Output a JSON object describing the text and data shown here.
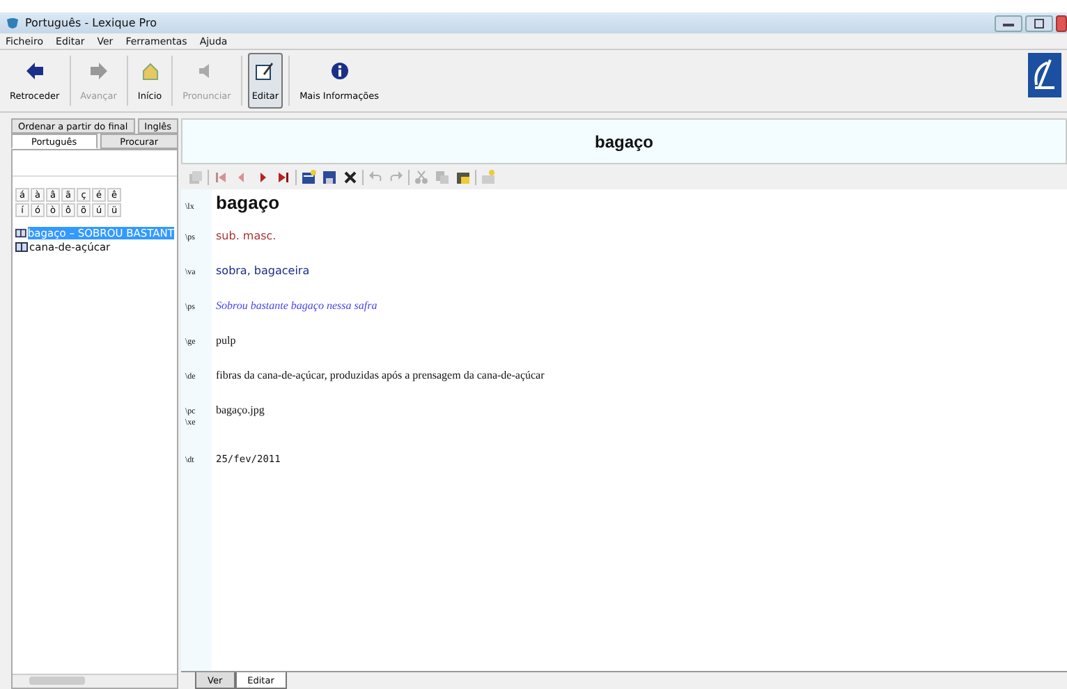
{
  "window": {
    "title": "Português - Lexique Pro"
  },
  "menu": [
    "Ficheiro",
    "Editar",
    "Ver",
    "Ferramentas",
    "Ajuda"
  ],
  "toolbar": [
    {
      "kind": "back",
      "label": "Retroceder",
      "disabled": false,
      "selected": false
    },
    {
      "kind": "forward",
      "label": "Avançar",
      "disabled": true,
      "selected": false
    },
    {
      "kind": "home",
      "label": "Início",
      "disabled": false,
      "selected": false
    },
    {
      "kind": "speaker",
      "label": "Pronunciar",
      "disabled": true,
      "selected": false
    },
    {
      "kind": "edit",
      "label": "Editar",
      "disabled": false,
      "selected": true
    },
    {
      "kind": "info",
      "label": "Mais Informações",
      "disabled": false,
      "selected": false
    }
  ],
  "index_tabs": [
    [
      {
        "label": "Ordenar a partir do final",
        "selected": false
      },
      {
        "label": "Inglês",
        "selected": false
      }
    ],
    [
      {
        "label": "Português",
        "selected": true
      },
      {
        "label": "Procurar",
        "selected": false
      }
    ]
  ],
  "special_chars": [
    [
      "á",
      "à",
      "â",
      "ã",
      "ç",
      "é",
      "ê"
    ],
    [
      "í",
      "ó",
      "ò",
      "ô",
      "õ",
      "ú",
      "ü"
    ]
  ],
  "word_list": [
    {
      "text": "bagaço – SOBROU BASTANT",
      "selected": true
    },
    {
      "text": "cana-de-açúcar",
      "selected": false
    }
  ],
  "entry_title": "bagaço",
  "editor_tools": [
    {
      "kind": "copy",
      "disabled": true
    },
    {
      "kind": "sep"
    },
    {
      "kind": "first",
      "disabled": true
    },
    {
      "kind": "prev",
      "disabled": true
    },
    {
      "kind": "next",
      "disabled": false
    },
    {
      "kind": "last",
      "disabled": false
    },
    {
      "kind": "sep"
    },
    {
      "kind": "new",
      "disabled": false
    },
    {
      "kind": "save",
      "disabled": false
    },
    {
      "kind": "delete",
      "disabled": false
    },
    {
      "kind": "sep"
    },
    {
      "kind": "undo",
      "disabled": true
    },
    {
      "kind": "redo",
      "disabled": true
    },
    {
      "kind": "sep"
    },
    {
      "kind": "cut",
      "disabled": true
    },
    {
      "kind": "paste",
      "disabled": true
    },
    {
      "kind": "clipboard",
      "disabled": false
    },
    {
      "kind": "sep"
    },
    {
      "kind": "abc",
      "disabled": false
    }
  ],
  "fields": [
    {
      "marker": "\\lx",
      "kind": "headword",
      "value": "bagaço"
    },
    {
      "marker": "\\ps",
      "kind": "pos",
      "value": "sub. masc."
    },
    {
      "marker": "\\va",
      "kind": "variant",
      "value": "sobra, bagaceira"
    },
    {
      "marker": "\\ps",
      "kind": "example",
      "value": "Sobrou bastante bagaço nessa safra"
    },
    {
      "marker": "\\ge",
      "kind": "plain",
      "value": "pulp"
    },
    {
      "marker": "\\de",
      "kind": "plain",
      "value": "fibras da cana-de-açúcar, produzidas após a prensagem da cana-de-açúcar"
    },
    {
      "marker": "\\pc",
      "kind": "plain",
      "value": "bagaço.jpg"
    },
    {
      "marker": "\\xe",
      "kind": "empty"
    },
    {
      "marker": "\\dt",
      "kind": "date",
      "value": "25/fev/2011"
    }
  ],
  "view_tabs": [
    {
      "label": "Ver",
      "selected": false
    },
    {
      "label": "Editar",
      "selected": true
    }
  ]
}
